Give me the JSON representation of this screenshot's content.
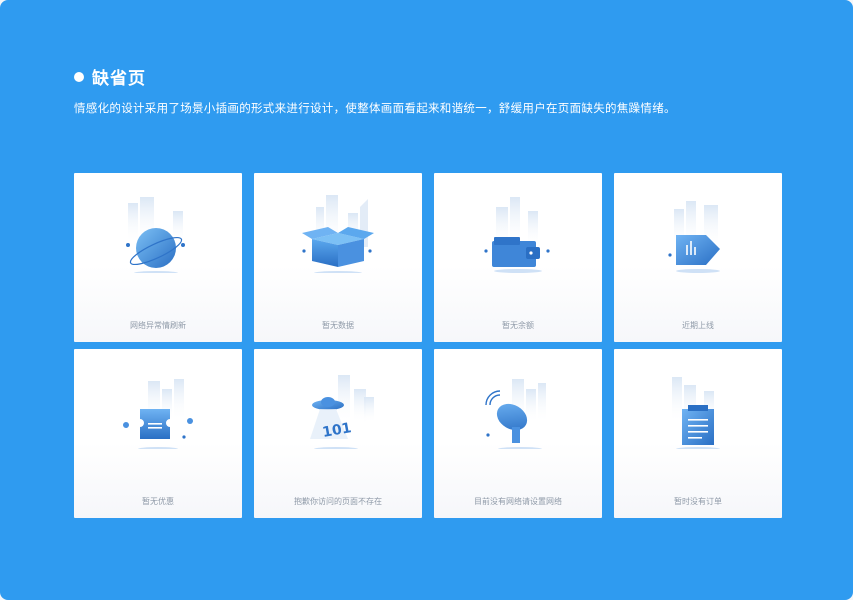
{
  "section": {
    "title": "缺省页",
    "description": "情感化的设计采用了场景小插画的形式来进行设计，使整体画面看起来和谐统一，舒缓用户在页面缺失的焦躁情绪。"
  },
  "cards": [
    {
      "label": "网络异常情刷新",
      "icon": "globe-icon"
    },
    {
      "label": "暂无数据",
      "icon": "open-box-icon"
    },
    {
      "label": "暂无余额",
      "icon": "wallet-icon"
    },
    {
      "label": "近期上线",
      "icon": "tag-chart-icon"
    },
    {
      "label": "暂无优惠",
      "icon": "coupon-ticket-icon"
    },
    {
      "label": "抱歉你访问的页面不存在",
      "icon": "ufo-404-icon"
    },
    {
      "label": "目前没有网络请设置网络",
      "icon": "satellite-dish-icon"
    },
    {
      "label": "暂时没有订单",
      "icon": "clipboard-icon"
    }
  ],
  "colors": {
    "background": "#2f9bf0",
    "card": "#ffffff",
    "label": "#8f9aa8",
    "icon_dark": "#2f74c9",
    "icon_light": "#6fb3f3"
  }
}
